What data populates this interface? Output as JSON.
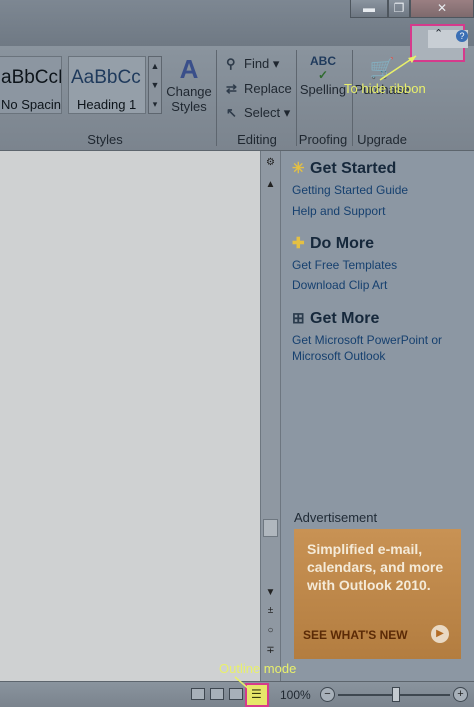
{
  "ribbon": {
    "styles": {
      "items": [
        {
          "preview": "aBbCcDd",
          "name": "No Spacing"
        },
        {
          "preview": "AaBbCc",
          "name": "Heading 1"
        }
      ],
      "change_styles": "Change Styles",
      "group_label": "Styles"
    },
    "editing": {
      "find": "Find",
      "replace": "Replace",
      "select": "Select",
      "group_label": "Editing"
    },
    "proofing": {
      "spelling": "Spelling",
      "group_label": "Proofing"
    },
    "upgrade": {
      "purchase": "Purchase",
      "group_label": "Upgrade"
    }
  },
  "annotations": {
    "hide_ribbon": "To hide ribbon",
    "outline_mode": "Outline mode"
  },
  "pane": {
    "sections": [
      {
        "title": "Get Started",
        "icon": "sparkle-icon",
        "links": [
          "Getting Started Guide",
          "Help and Support"
        ]
      },
      {
        "title": "Do More",
        "icon": "plus-icon",
        "links": [
          "Get Free Templates",
          "Download Clip Art"
        ]
      },
      {
        "title": "Get More",
        "icon": "cart-icon",
        "links": [
          "Get Microsoft PowerPoint or",
          "Microsoft Outlook"
        ]
      }
    ],
    "ad_label": "Advertisement",
    "ad_text": "Simplified e-mail, calendars, and more with Outlook 2010.",
    "ad_cta": "SEE WHAT'S NEW"
  },
  "status": {
    "zoom": "100%"
  },
  "colors": {
    "highlight_box": "#d63a8c",
    "annotation_text": "#e9f06a"
  }
}
